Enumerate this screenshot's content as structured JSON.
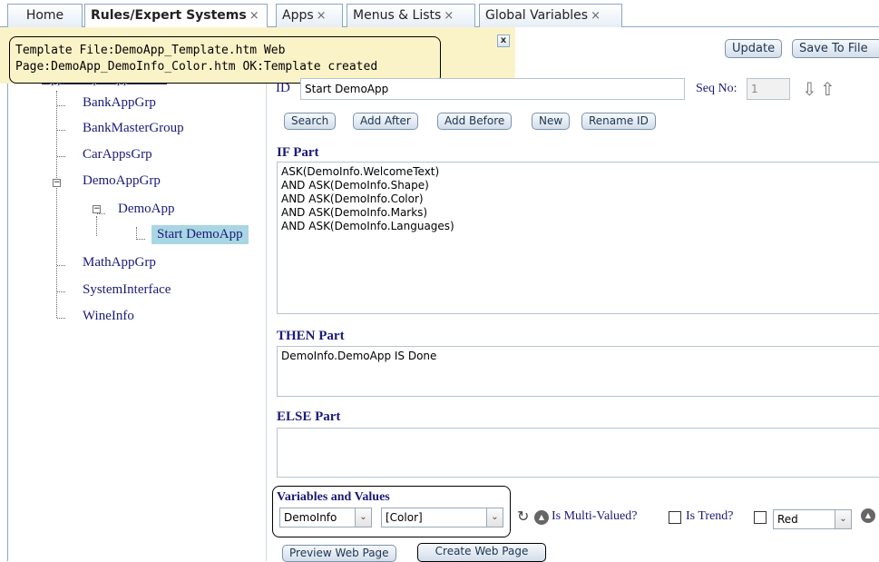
{
  "tabs": [
    {
      "label": "Home",
      "closable": false
    },
    {
      "label": "Rules/Expert Systems",
      "closable": true,
      "active": true
    },
    {
      "label": "Apps",
      "closable": true
    },
    {
      "label": "Menus & Lists",
      "closable": true
    },
    {
      "label": "Global Variables",
      "closable": true
    }
  ],
  "close_glyph": "×",
  "toast": {
    "line1": "Template File:DemoApp_Template.htm Web",
    "line2": "Page:DemoApp_DemoInfo_Color.htm OK:Template created",
    "close_label": "x"
  },
  "tree": {
    "header": "App Groups/Apps/Rules",
    "items": [
      {
        "label": "BankAppGrp"
      },
      {
        "label": "BankMasterGroup"
      },
      {
        "label": "CarAppsGrp"
      },
      {
        "label": "DemoAppGrp"
      },
      {
        "label": "DemoApp"
      },
      {
        "label": "Start DemoApp",
        "selected": true
      },
      {
        "label": "MathAppGrp"
      },
      {
        "label": "SystemInterface"
      },
      {
        "label": "WineInfo"
      }
    ],
    "expander_minus": "−"
  },
  "toolbar": {
    "update_label": "Update",
    "save_label": "Save To File"
  },
  "rule": {
    "id_label": "ID",
    "id_value": "Start DemoApp",
    "seq_label": "Seq No:",
    "seq_value": "1",
    "buttons": {
      "search": "Search",
      "add_after": "Add After",
      "add_before": "Add Before",
      "new": "New",
      "rename": "Rename ID"
    }
  },
  "if_part": {
    "title": "IF Part",
    "text": "ASK(DemoInfo.WelcomeText)\nAND ASK(DemoInfo.Shape)\nAND ASK(DemoInfo.Color)\nAND ASK(DemoInfo.Marks)\nAND ASK(DemoInfo.Languages)"
  },
  "then_part": {
    "title": "THEN Part",
    "text": "DemoInfo.DemoApp IS Done"
  },
  "else_part": {
    "title": "ELSE Part",
    "text": ""
  },
  "variables": {
    "title": "Variables and Values",
    "object_select": "DemoInfo",
    "variable_select": "[Color]",
    "multi_valued_label": "Is Multi-Valued?",
    "trend_label": "Is Trend?",
    "value_select": "Red"
  },
  "bottom_buttons": {
    "preview": "Preview Web Page",
    "create": "Create Web Page"
  },
  "icons": {
    "arrow_down": "⇩",
    "arrow_up": "⇧",
    "refresh": "↻",
    "dropdown": "⌄",
    "up_circle": "▲"
  }
}
